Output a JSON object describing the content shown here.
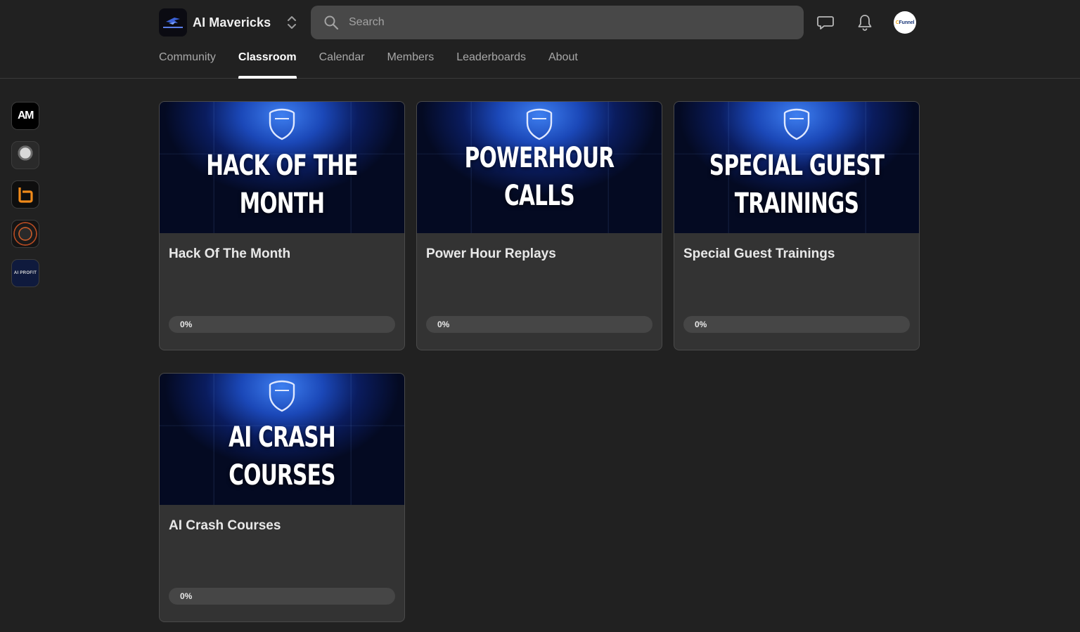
{
  "header": {
    "brand_name": "AI Mavericks",
    "search_placeholder": "Search",
    "avatar_text_a": "C",
    "avatar_text_b": "Funnel"
  },
  "tabs": [
    {
      "label": "Community",
      "active": false
    },
    {
      "label": "Classroom",
      "active": true
    },
    {
      "label": "Calendar",
      "active": false
    },
    {
      "label": "Members",
      "active": false
    },
    {
      "label": "Leaderboards",
      "active": false
    },
    {
      "label": "About",
      "active": false
    }
  ],
  "rail": {
    "am_label": "AM",
    "profit_label": "AI PROFIT"
  },
  "courses": [
    {
      "thumb_line1": "HACK OF THE",
      "thumb_line2": "MONTH",
      "title": "Hack Of The Month",
      "progress_label": "0%",
      "progress": 0
    },
    {
      "thumb_line1": "POWERHOUR CALLS",
      "thumb_line2": "",
      "title": "Power Hour Replays",
      "progress_label": "0%",
      "progress": 0
    },
    {
      "thumb_line1": "SPECIAL GUEST",
      "thumb_line2": "TRAININGS",
      "title": "Special Guest Trainings",
      "progress_label": "0%",
      "progress": 0
    },
    {
      "thumb_line1": "AI CRASH",
      "thumb_line2": "COURSES",
      "title": "AI Crash Courses",
      "progress_label": "0%",
      "progress": 0
    }
  ],
  "colors": {
    "background": "#212121",
    "card": "#333333",
    "search": "#484848",
    "thumb_blue": "#1b48b8"
  }
}
